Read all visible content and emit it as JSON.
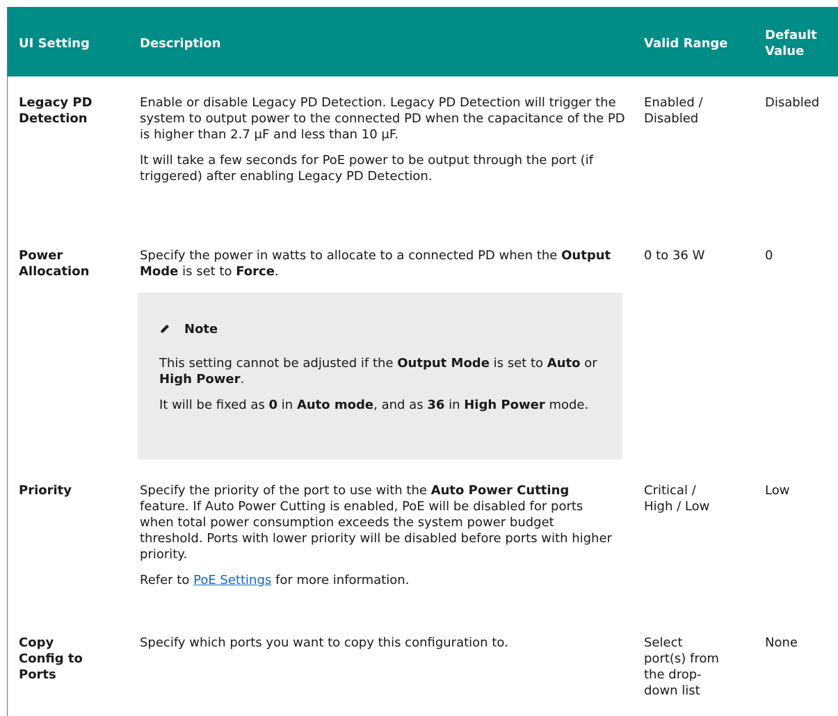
{
  "header": {
    "ui_setting": "UI Setting",
    "description": "Description",
    "valid_range": "Valid Range",
    "default_line1": "Default",
    "default_line2": "Value"
  },
  "rows": [
    {
      "setting_line1": "Legacy PD",
      "setting_line2": "Detection",
      "desc_p1": "Enable or disable Legacy PD Detection. Legacy PD Detection will trigger the system to output power to the connected PD when the capacitance of the PD is higher than 2.7 μF and less than 10 μF.",
      "desc_p2": "It will take a few seconds for PoE power to be output through the port (if triggered) after enabling Legacy PD Detection.",
      "range_line1": "Enabled /",
      "range_line2": "Disabled",
      "default": "Disabled"
    },
    {
      "setting_line1": "Power",
      "setting_line2": "Allocation",
      "desc_a": "Specify the power in watts to allocate to a connected PD when the ",
      "desc_b": "Output Mode",
      "desc_c": " is set to ",
      "desc_d": "Force",
      "desc_e": ".",
      "range": "0 to 36 W",
      "default": "0",
      "note": {
        "title": "Note",
        "p1_a": "This setting cannot be adjusted if the ",
        "p1_b": "Output Mode",
        "p1_c": " is set to ",
        "p1_d": "Auto",
        "p1_e": " or ",
        "p1_f": "High Power",
        "p1_g": ".",
        "p2_a": "It will be fixed as ",
        "p2_b": "0",
        "p2_c": " in ",
        "p2_d": "Auto mode",
        "p2_e": ", and as ",
        "p2_f": "36",
        "p2_g": " in ",
        "p2_h": "High Power",
        "p2_i": " mode."
      }
    },
    {
      "setting": "Priority",
      "desc_a": "Specify the priority of the port to use with the ",
      "desc_b": "Auto Power Cutting",
      "desc_c": " feature. If Auto Power Cutting is enabled, PoE will be disabled for ports when total power consumption exceeds the system power budget threshold. Ports with lower priority will be disabled before ports with higher priority.",
      "refer_a": "Refer to ",
      "refer_link": "PoE Settings",
      "refer_b": " for more information.",
      "range_line1": "Critical /",
      "range_line2": "High / Low",
      "default": "Low"
    },
    {
      "setting_line1": "Copy",
      "setting_line2": "Config to",
      "setting_line3": "Ports",
      "desc": "Specify which ports you want to copy this configuration to.",
      "range_line1": "Select",
      "range_line2": "port(s) from",
      "range_line3": "the drop-",
      "range_line4": "down list",
      "default": "None"
    }
  ],
  "colors": {
    "header_bg": "#008c87",
    "note_bg": "#ebebeb",
    "link": "#1565c0"
  },
  "icons": {
    "note": "pencil-icon"
  }
}
